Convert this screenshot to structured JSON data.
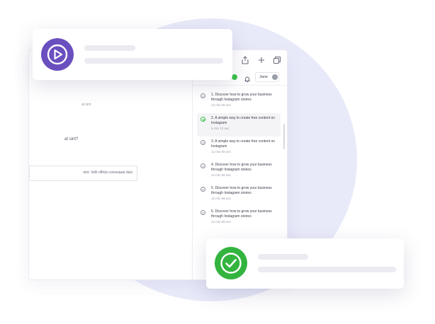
{
  "main": {
    "faded_line": "at sint",
    "question": "at sint?",
    "answer": "oint. Velit officia consequat duis"
  },
  "user": {
    "name": "Jane",
    "status_color": "#3bc24a"
  },
  "toolbar": {
    "icons": [
      "share-icon",
      "add-icon",
      "copy-icon"
    ]
  },
  "lessons": [
    {
      "title": "1. Discover how to grow your business through Instagram stories",
      "meta": "12 min 06 sec",
      "active": false
    },
    {
      "title": "2. A simple way to create free content on Instagram",
      "meta": "6 min 12 sec",
      "active": true
    },
    {
      "title": "3. A simple way to create free content on Instagram",
      "meta": "12 min 06 sec",
      "active": false
    },
    {
      "title": "4. Discover how to grow your business through Instagram stories",
      "meta": "12 min 06 sec",
      "active": false
    },
    {
      "title": "5. Discover how to grow your business through Instagram stories",
      "meta": "12 min 06 sec",
      "active": false
    },
    {
      "title": "6. Discover how to grow your business through Instagram stories",
      "meta": "12 min 06 sec",
      "active": false
    }
  ],
  "colors": {
    "video_accent": "#6a4fbf",
    "success_accent": "#33b43f",
    "background_circle": "#e9eaf9"
  }
}
